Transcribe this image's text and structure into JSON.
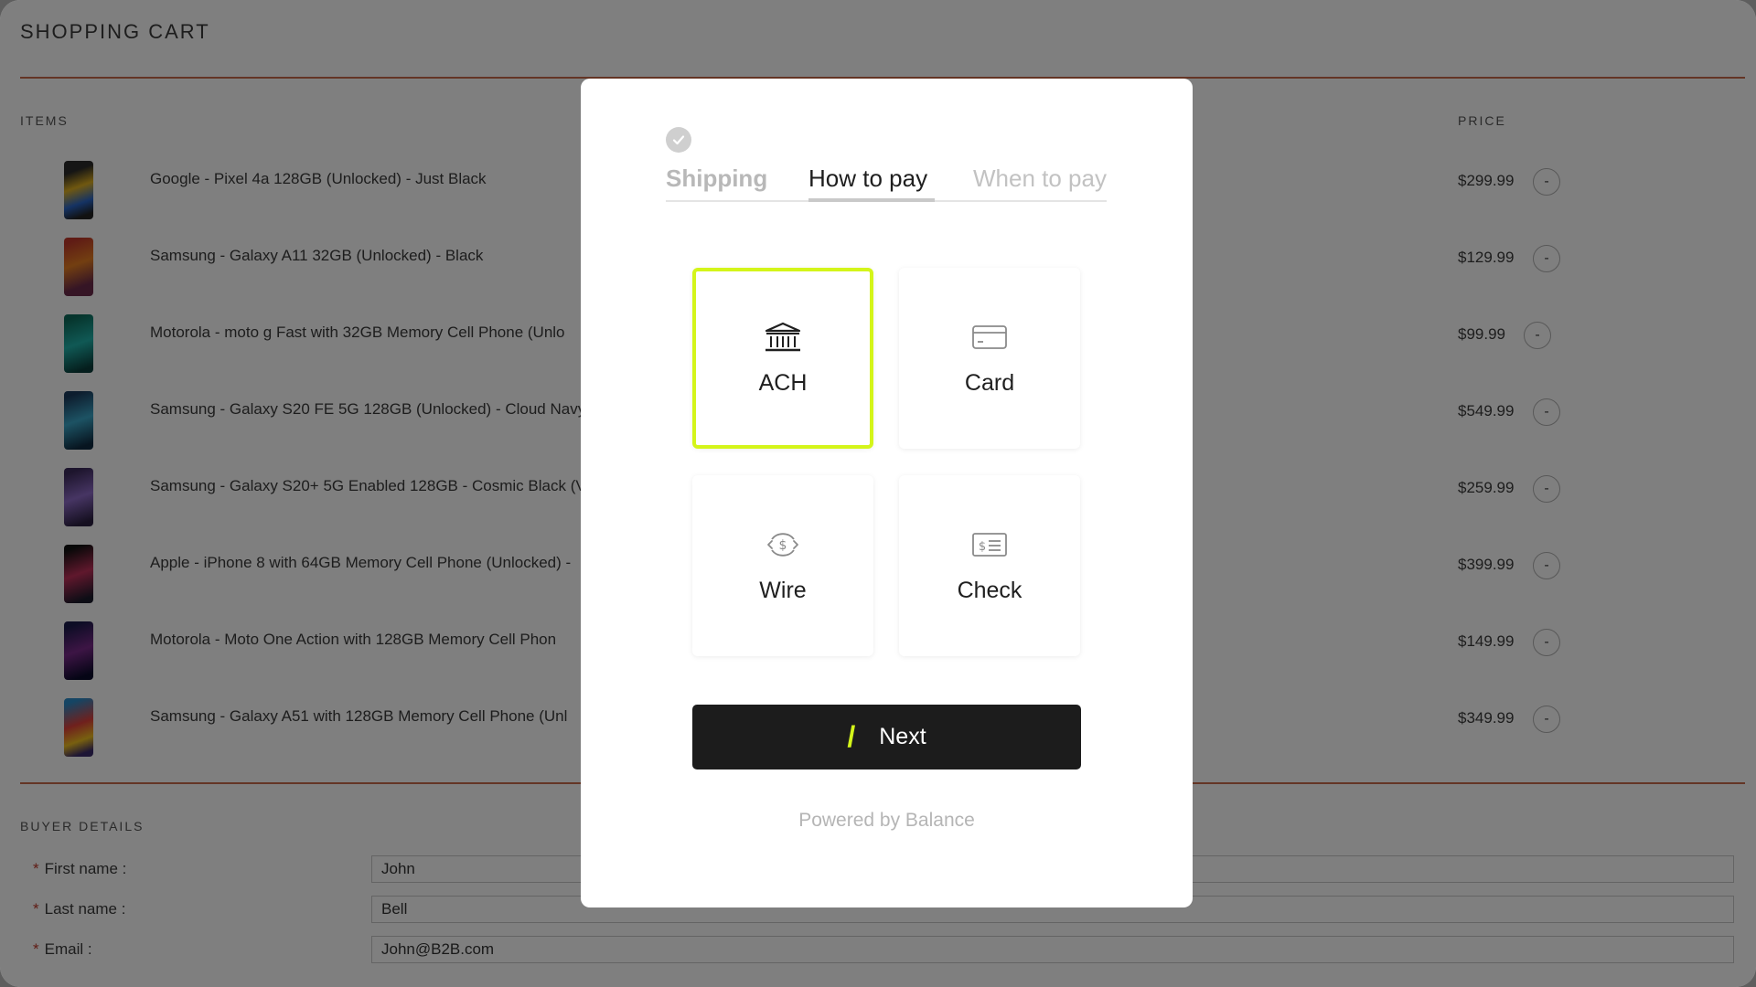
{
  "cart": {
    "title": "SHOPPING CART",
    "items_header": "ITEMS",
    "price_header": "PRICE",
    "remove_label": "-",
    "items": [
      {
        "name": "Google - Pixel 4a 128GB (Unlocked) - Just Black",
        "price": "$299.99"
      },
      {
        "name": "Samsung - Galaxy A11 32GB (Unlocked) - Black",
        "price": "$129.99"
      },
      {
        "name": "Motorola - moto g Fast with 32GB Memory Cell Phone (Unlo",
        "price": "$99.99"
      },
      {
        "name": "Samsung - Galaxy S20 FE 5G 128GB (Unlocked) - Cloud Navy",
        "price": "$549.99"
      },
      {
        "name": "Samsung - Galaxy S20+ 5G Enabled 128GB - Cosmic Black (V",
        "price": "$259.99"
      },
      {
        "name": "Apple - iPhone 8 with 64GB Memory Cell Phone (Unlocked) -",
        "price": "$399.99"
      },
      {
        "name": "Motorola - Moto One Action with 128GB Memory Cell Phon",
        "price": "$149.99"
      },
      {
        "name": "Samsung - Galaxy A51 with 128GB Memory Cell Phone (Unl",
        "price": "$349.99"
      }
    ]
  },
  "buyer": {
    "header": "BUYER DETAILS",
    "required_mark": "*",
    "first_name_label": "First name :",
    "first_name_value": "John",
    "last_name_label": "Last name :",
    "last_name_value": "Bell",
    "email_label": "Email :",
    "email_value": "John@B2B.com"
  },
  "modal": {
    "tabs": {
      "shipping": "Shipping",
      "how_to_pay": "How to pay",
      "when_to_pay": "When to pay"
    },
    "methods": {
      "ach": "ACH",
      "card": "Card",
      "wire": "Wire",
      "check": "Check"
    },
    "selected_method": "ACH",
    "next_label": "Next",
    "powered_by": "Powered by Balance"
  },
  "colors": {
    "accent_lime": "#d4f51a",
    "button_dark": "#1c1c1c",
    "rule_orange": "#c86a4a"
  },
  "icons": {
    "shipping_done": "check-circle-icon",
    "ach": "bank-icon",
    "card": "credit-card-icon",
    "wire": "wire-transfer-icon",
    "check": "check-cheque-icon",
    "next": "slash-icon"
  }
}
